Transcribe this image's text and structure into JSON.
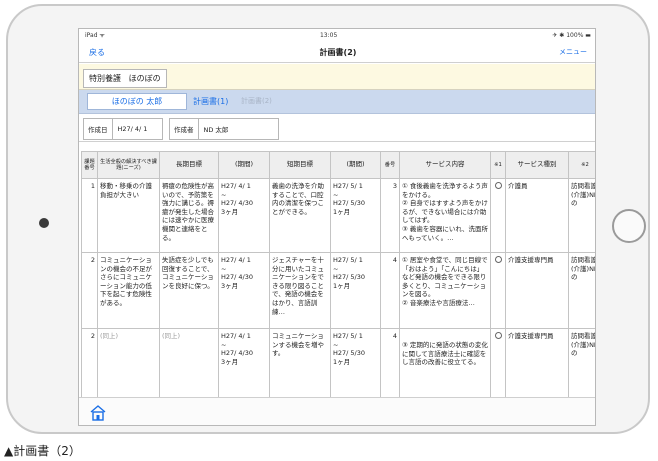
{
  "status": {
    "left": "iPad ᯤ",
    "time": "13:05",
    "battery": "✈ ✱ 100% ▬"
  },
  "nav": {
    "back": "戻る",
    "title": "計画書(2)",
    "menu": "メニュー"
  },
  "service": {
    "type": "特別養護",
    "name": "ほのぼの"
  },
  "tabs": {
    "person": "ほのぼの 太郎",
    "plan1": "計画書(1)",
    "plan2": "計画書(2)"
  },
  "meta": {
    "date_label": "作成日",
    "date_value": "H27/ 4/ 1",
    "author_label": "作成者",
    "author_value": "ND 太郎"
  },
  "table": {
    "headers": {
      "issue_no": "課題番号",
      "issue": "生活全般の解決すべき課題(ニーズ)",
      "long_goal": "長期目標",
      "long_period": "(期間)",
      "short_goal": "短期目標",
      "short_period": "(期間)",
      "no": "番号",
      "service": "サービス内容",
      "mark1": "※1",
      "service_type": "サービス種別",
      "mark2": "※2"
    },
    "rows": [
      {
        "issue_no": "1",
        "issue": "移動・移乗の介護負担が大きい",
        "long_goal": "褥瘡の危険性が高いので、予防策を強力に講じる。褥瘡が発生した場合には速やかに医療機関と連絡をとる。",
        "long_period": "H27/ 4/ 1\n~\nH27/ 4/30\n3ヶ月",
        "short_goal": "義歯の洗浄を介助することで、口腔内の清潔を保つことができる。",
        "short_period": "H27/ 5/ 1\n~\nH27/ 5/30\n1ヶ月",
        "no": "3",
        "service": "① 食後義歯を洗浄するよう声をかける。\n② 自身ではすすよう声をかけるが、できない場合には介助してはず。\n③ 義歯を容器にいれ、洗面所へもっていく。…",
        "service_type": "介護員",
        "mark2": "訪問看護(介護)NDの"
      },
      {
        "issue_no": "2",
        "issue": "コミュニケーションの機会の不足がさらにコミュニケーション能力の低下を起こす危険性がある。",
        "long_goal": "失語症を少しでも回復することで、コミュニケーションを良好に保つ。",
        "long_period": "H27/ 4/ 1\n~\nH27/ 4/30\n3ヶ月",
        "short_goal": "ジェスチャーを十分に用いたコミュニケーションをできる限り図ることで、発語の機会をはかり、言語訓練…",
        "short_period": "H27/ 5/ 1\n~\nH27/ 5/30\n1ヶ月",
        "no": "4",
        "service": "① 居室や食堂で、同じ目線で「おはよう」「こんにちは」など発語の機会をできる限り多くとり、コミュニケーションを図る。\n② 音楽療法や言語療法…",
        "service_type": "介護支援専門員",
        "mark2": "訪問看護(介護)NDの"
      },
      {
        "issue_no": "2",
        "issue": "(同上)",
        "long_goal": "(同上)",
        "long_period": "H27/ 4/ 1\n~\nH27/ 4/30\n3ヶ月",
        "short_goal": "コミュニケーションする機会を増やす。",
        "short_period": "H27/ 5/ 1\n~\nH27/ 5/30\n1ヶ月",
        "no": "4",
        "service": "③ 定期的に発語の状態の変化に関して言語療法士に確認をし言語の改善に役立てる。",
        "service_type": "介護支援専門員",
        "mark2": "訪問看護(介護)NDの"
      }
    ]
  },
  "caption": "▲計画書（2）"
}
